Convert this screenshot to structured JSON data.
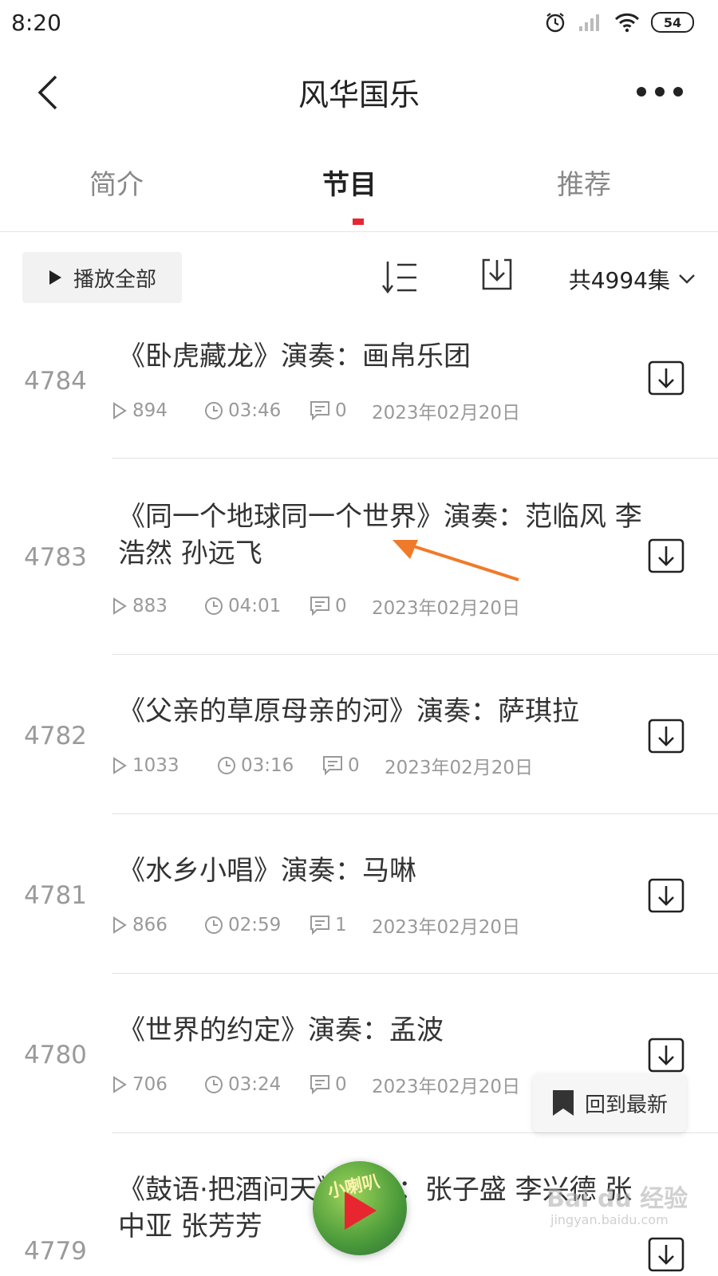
{
  "status_bar": {
    "time": "8:20",
    "battery": "54"
  },
  "header": {
    "title": "风华国乐"
  },
  "tabs": [
    {
      "label": "简介"
    },
    {
      "label": "节目"
    },
    {
      "label": "推荐"
    }
  ],
  "toolbar": {
    "play_all": "播放全部",
    "count": "共4994集"
  },
  "episodes": [
    {
      "num": "4784",
      "title": "《卧虎藏龙》演奏：画帛乐团",
      "plays": "894",
      "duration": "03:46",
      "comments": "0",
      "date": "2023年02月20日"
    },
    {
      "num": "4783",
      "title": "《同一个地球同一个世界》演奏：范临风 李浩然 孙远飞",
      "plays": "883",
      "duration": "04:01",
      "comments": "0",
      "date": "2023年02月20日"
    },
    {
      "num": "4782",
      "title": "《父亲的草原母亲的河》演奏：萨琪拉",
      "plays": "1033",
      "duration": "03:16",
      "comments": "0",
      "date": "2023年02月20日"
    },
    {
      "num": "4781",
      "title": "《水乡小唱》演奏：马啉",
      "plays": "866",
      "duration": "02:59",
      "comments": "1",
      "date": "2023年02月20日"
    },
    {
      "num": "4780",
      "title": "《世界的约定》演奏：孟波",
      "plays": "706",
      "duration": "03:24",
      "comments": "0",
      "date": "2023年02月20日"
    },
    {
      "num": "4779",
      "title": "《鼓语·把酒问天》演奏：张子盛 李兴德 张中亚 张芳芳"
    }
  ],
  "floating": {
    "back_to_latest": "回到最新"
  },
  "mini_player": {
    "brand": "小喇叭"
  },
  "watermark": {
    "text": "Bai du 经验",
    "url": "jingyan.baidu.com"
  },
  "colors": {
    "accent": "#e8262f",
    "text": "#333333",
    "muted": "#999999"
  }
}
